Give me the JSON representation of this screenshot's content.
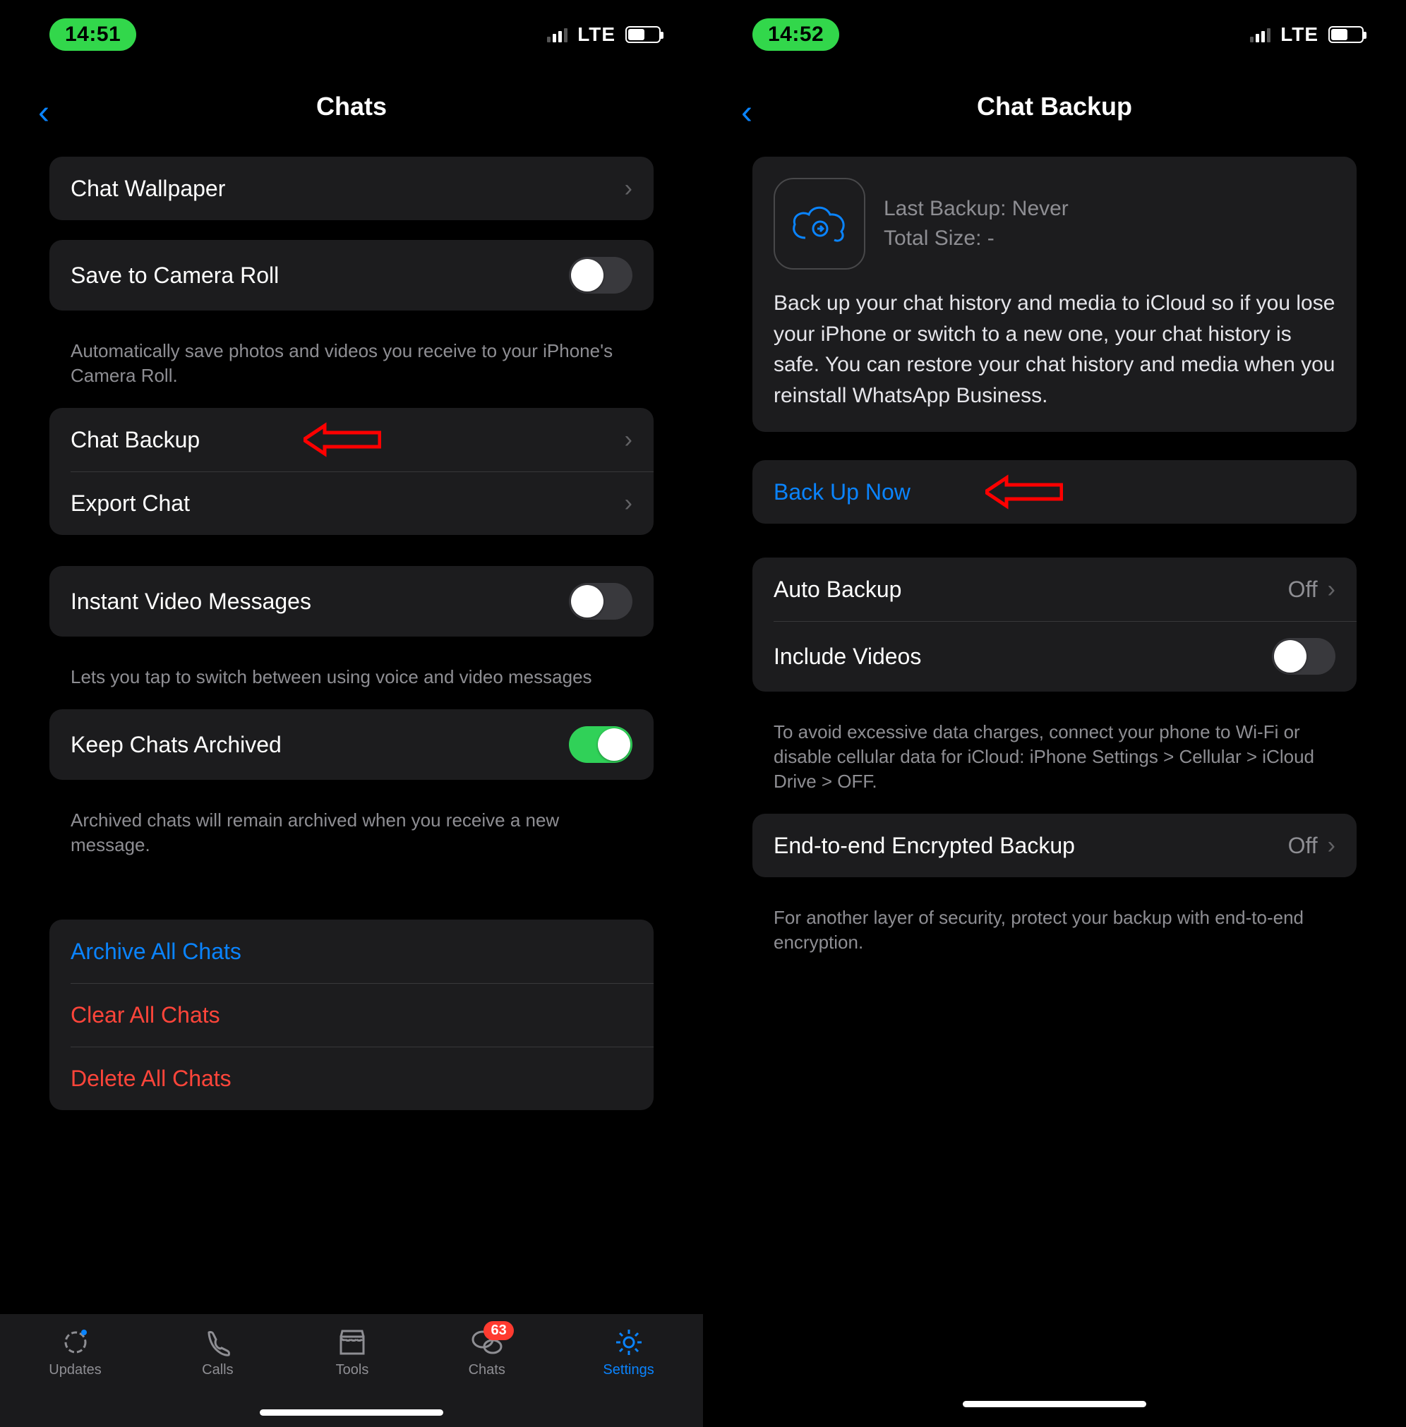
{
  "left": {
    "status": {
      "time": "14:51",
      "network": "LTE"
    },
    "header": {
      "title": "Chats"
    },
    "wallpaper": {
      "label": "Chat Wallpaper"
    },
    "cameraRoll": {
      "label": "Save to Camera Roll",
      "note": "Automatically save photos and videos you receive to your iPhone's Camera Roll."
    },
    "backup": {
      "label": "Chat Backup"
    },
    "exportChat": {
      "label": "Export Chat"
    },
    "instantVideo": {
      "label": "Instant Video Messages",
      "note": "Lets you tap to switch between using voice and video messages"
    },
    "keepArchived": {
      "label": "Keep Chats Archived",
      "note": "Archived chats will remain archived when you receive a new message."
    },
    "archiveAll": {
      "label": "Archive All Chats"
    },
    "clearAll": {
      "label": "Clear All Chats"
    },
    "deleteAll": {
      "label": "Delete All Chats"
    },
    "tabs": {
      "updates": "Updates",
      "calls": "Calls",
      "tools": "Tools",
      "chats": "Chats",
      "settings": "Settings",
      "chatsBadge": "63"
    }
  },
  "right": {
    "status": {
      "time": "14:52",
      "network": "LTE"
    },
    "header": {
      "title": "Chat Backup"
    },
    "card": {
      "lastBackup": "Last Backup: Never",
      "totalSize": "Total Size: -",
      "desc": "Back up your chat history and media to iCloud so if you lose your iPhone or switch to a new one, your chat history is safe. You can restore your chat history and media when you reinstall WhatsApp Business."
    },
    "backupNow": {
      "label": "Back Up Now"
    },
    "autoBackup": {
      "label": "Auto Backup",
      "value": "Off"
    },
    "includeVideos": {
      "label": "Include Videos",
      "note": "To avoid excessive data charges, connect your phone to Wi-Fi or disable cellular data for iCloud: iPhone Settings > Cellular > iCloud Drive > OFF."
    },
    "e2e": {
      "label": "End-to-end Encrypted Backup",
      "value": "Off",
      "note": "For another layer of security, protect your backup with end-to-end encryption."
    }
  }
}
